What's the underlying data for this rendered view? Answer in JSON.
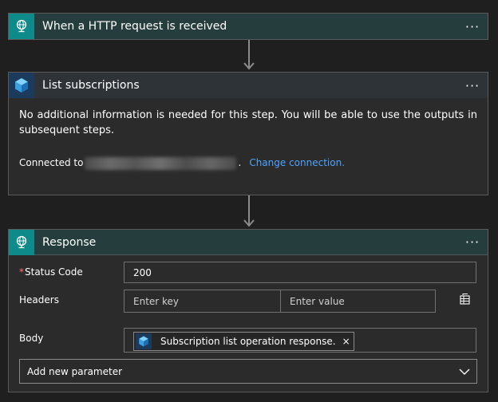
{
  "http_trigger": {
    "title": "When a HTTP request is received",
    "icon": "globe-icon",
    "more_label": "···"
  },
  "list_subscriptions": {
    "title": "List subscriptions",
    "icon": "cube-icon",
    "more_label": "···",
    "info_text": "No additional information is needed for this step. You will be able to use the outputs in subsequent steps.",
    "connected_to_label": "Connected to",
    "connection_suffix": ".",
    "change_connection_label": "Change connection."
  },
  "response": {
    "title": "Response",
    "icon": "globe-icon",
    "more_label": "···",
    "status_code": {
      "required_mark": "*",
      "label": "Status Code",
      "value": "200"
    },
    "headers": {
      "label": "Headers",
      "key_placeholder": "Enter key",
      "value_placeholder": "Enter value",
      "switch_icon": "switch-mode-icon"
    },
    "body": {
      "label": "Body",
      "token_label": "Subscription list operation response.",
      "token_remove": "×"
    },
    "add_parameter": {
      "label": "Add new parameter",
      "icon": "chevron-down-icon"
    }
  },
  "colors": {
    "background": "#1f1f1f",
    "card": "#2b2b2b",
    "http_header": "#253e3d",
    "teal_icon": "#0e8a8a",
    "navy_icon": "#1b3a5c",
    "link": "#4fa3ff",
    "required": "#ff6e6e"
  }
}
